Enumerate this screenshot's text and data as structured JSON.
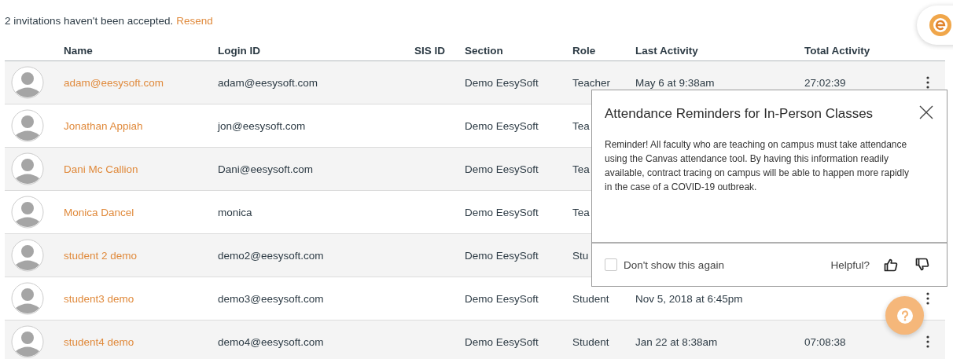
{
  "notice": {
    "text": "2 invitations haven't been accepted.",
    "link": "Resend"
  },
  "table": {
    "columns": [
      "Name",
      "Login ID",
      "SIS ID",
      "Section",
      "Role",
      "Last Activity",
      "Total Activity"
    ],
    "rows": [
      {
        "name": "adam@eesysoft.com",
        "login_id": "adam@eesysoft.com",
        "section": "Demo EesySoft",
        "role": "Teacher",
        "last_activity": "May 6 at 9:38am",
        "total_activity": "27:02:39",
        "menu": true
      },
      {
        "name": "Jonathan Appiah",
        "login_id": "jon@eesysoft.com",
        "section": "Demo EesySoft",
        "role": "Tea",
        "menu": false
      },
      {
        "name": "Dani Mc Callion",
        "login_id": "Dani@eesysoft.com",
        "section": "Demo EesySoft",
        "role": "Tea",
        "menu": false
      },
      {
        "name": "Monica Dancel",
        "login_id": "monica",
        "section": "Demo EesySoft",
        "role": "Tea",
        "menu": false
      },
      {
        "name": "student 2 demo",
        "login_id": "demo2@eesysoft.com",
        "section": "Demo EesySoft",
        "role": "Stu",
        "menu": false
      },
      {
        "name": "student3 demo",
        "login_id": "demo3@eesysoft.com",
        "section": "Demo EesySoft",
        "role": "Student",
        "last_activity": "Nov 5, 2018 at 6:45pm",
        "menu": true
      },
      {
        "name": "student4 demo",
        "login_id": "demo4@eesysoft.com",
        "section": "Demo EesySoft",
        "role": "Student",
        "last_activity": "Jan 22 at 8:38am",
        "total_activity": "07:08:38",
        "menu": true
      }
    ]
  },
  "popup": {
    "title": "Attendance Reminders for In-Person Classes",
    "body": "Reminder! All faculty who are teaching on campus must take attendance using the Canvas attendance tool. By having this information readily available, contract tracing on campus will be able to happen more rapidly in the case of a COVID-19 outbreak.",
    "dont_show": {
      "label": "Don't show this again",
      "checked": false
    },
    "helpful_label": "Helpful?"
  }
}
